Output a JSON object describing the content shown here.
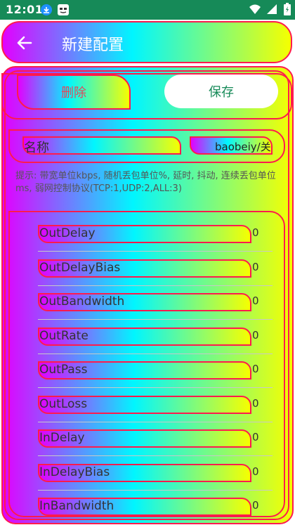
{
  "status_bar": {
    "time": "12:01",
    "left_icons": [
      "download-icon",
      "app-mask-icon"
    ],
    "right_icons": [
      "wifi-icon",
      "signal-icon",
      "battery-icon"
    ]
  },
  "app_bar": {
    "title": "新建配置",
    "back_icon": "arrow-left-icon"
  },
  "actions": {
    "delete_label": "删除",
    "save_label": "保存"
  },
  "name_field": {
    "label": "名称",
    "value": "baobeiy/关"
  },
  "hint": "提示: 带宽单位kbps, 随机丢包单位%, 延时, 抖动, 连续丢包单位ms, 弱网控制协议(TCP:1,UDP:2,ALL:3)",
  "params": [
    {
      "label": "OutDelay",
      "value": "0"
    },
    {
      "label": "OutDelayBias",
      "value": "0"
    },
    {
      "label": "OutBandwidth",
      "value": "0"
    },
    {
      "label": "OutRate",
      "value": "0"
    },
    {
      "label": "OutPass",
      "value": "0"
    },
    {
      "label": "OutLoss",
      "value": "0"
    },
    {
      "label": "InDelay",
      "value": "0"
    },
    {
      "label": "InDelayBias",
      "value": "0"
    },
    {
      "label": "InBandwidth",
      "value": "0"
    }
  ],
  "colors": {
    "status_bar": "#168a58",
    "border": "#ff1a4d",
    "gradient": [
      "#e200ff",
      "#00f6ff",
      "#f6ff00"
    ],
    "save_text": "#168a58",
    "delete_text": "#e2485a"
  }
}
